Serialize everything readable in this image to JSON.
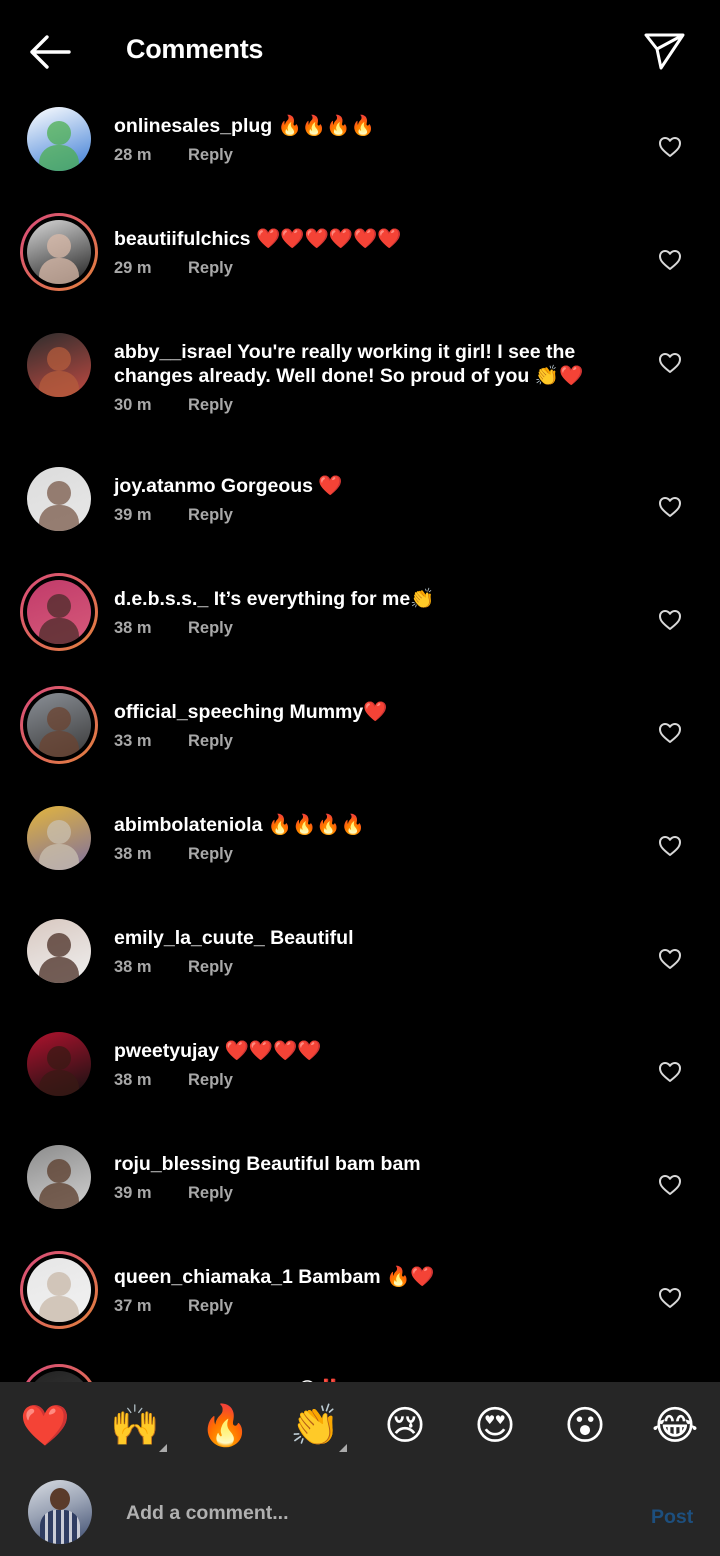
{
  "header": {
    "title": "Comments",
    "back_icon": "arrow-left-icon",
    "share_icon": "paper-plane-icon"
  },
  "reply_label": "Reply",
  "comments": [
    {
      "user": "onlinesales_plug",
      "text": "🔥🔥🔥🔥",
      "time": "28 m",
      "story": false,
      "avatar_colors": [
        "#ffffff",
        "#4caf50",
        "#3a7bd5"
      ]
    },
    {
      "user": "beautiifulchics",
      "text": "❤️❤️❤️❤️❤️❤️",
      "time": "29 m",
      "story": true,
      "avatar_colors": [
        "#d8d8d8",
        "#d9b9a8",
        "#1e1e1e"
      ]
    },
    {
      "user": "abby__israel",
      "text": "You're really working it girl! I see the changes already. Well done! So proud of you 👏❤️",
      "time": "30 m",
      "story": false,
      "avatar_colors": [
        "#2d2d2d",
        "#b45c3c",
        "#c24a42"
      ]
    },
    {
      "user": "joy.atanmo",
      "text": "Gorgeous ❤️",
      "time": "39 m",
      "story": false,
      "avatar_colors": [
        "#dcdcdc",
        "#7a5a4a",
        "#e8e8e8"
      ]
    },
    {
      "user": "d.e.b.s.s._",
      "text": "It’s everything for me👏",
      "time": "38 m",
      "story": true,
      "avatar_colors": [
        "#c13b6a",
        "#4a2c2a",
        "#d65a7a"
      ]
    },
    {
      "user": "official_speeching",
      "text": "Mummy❤️",
      "time": "33 m",
      "story": true,
      "avatar_colors": [
        "#8a8f96",
        "#6b4330",
        "#3a3a3a"
      ]
    },
    {
      "user": "abimbolateniola",
      "text": "🔥🔥🔥🔥",
      "time": "38 m",
      "story": false,
      "avatar_colors": [
        "#e3b53d",
        "#c9c0b0",
        "#7d6fa0"
      ]
    },
    {
      "user": "emily_la_cuute_",
      "text": "Beautiful",
      "time": "38 m",
      "story": false,
      "avatar_colors": [
        "#d8c8c0",
        "#4a2e24",
        "#f0f0f0"
      ]
    },
    {
      "user": "pweetyujay",
      "text": "❤️❤️❤️❤️",
      "time": "38 m",
      "story": false,
      "avatar_colors": [
        "#b0132e",
        "#3a1a14",
        "#111111"
      ]
    },
    {
      "user": "roju_blessing",
      "text": "Beautiful bam bam",
      "time": "39 m",
      "story": false,
      "avatar_colors": [
        "#8c8c8c",
        "#5a3b2a",
        "#d0d0d0"
      ]
    },
    {
      "user": "queen_chiamaka_1",
      "text": "Bambam 🔥❤️",
      "time": "37 m",
      "story": true,
      "avatar_colors": [
        "#e6e6e6",
        "#c8b8a8",
        "#f2f2f2"
      ]
    },
    {
      "user": "zala_intimates",
      "text": "BAM😍‼️",
      "time": "",
      "story": true,
      "avatar_colors": [
        "#222222",
        "#a05050",
        "#444444"
      ]
    }
  ],
  "emoji_bar": [
    {
      "emoji": "❤️",
      "name": "heart",
      "has_variants": false
    },
    {
      "emoji": "🙌",
      "name": "raising-hands",
      "has_variants": true
    },
    {
      "emoji": "🔥",
      "name": "fire",
      "has_variants": false
    },
    {
      "emoji": "👏",
      "name": "clapping-hands",
      "has_variants": true
    },
    {
      "emoji": "😢",
      "name": "crying-face",
      "has_variants": false
    },
    {
      "emoji": "😍",
      "name": "heart-eyes",
      "has_variants": false
    },
    {
      "emoji": "😮",
      "name": "surprised-face",
      "has_variants": false
    },
    {
      "emoji": "😂",
      "name": "tears-of-joy",
      "has_variants": false
    }
  ],
  "composer": {
    "placeholder": "Add a comment...",
    "post_label": "Post",
    "post_color": "#1d4f7e"
  }
}
